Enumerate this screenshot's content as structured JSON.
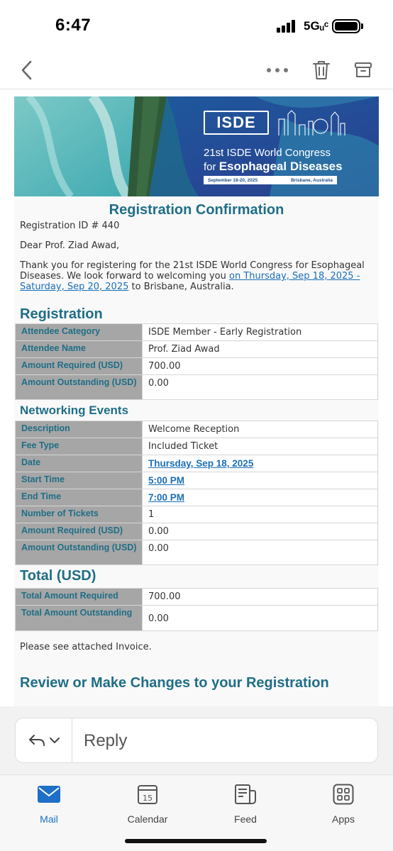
{
  "status_bar": {
    "time": "6:47",
    "network": "5Gᵤᶜ"
  },
  "email": {
    "banner": {
      "logo": "ISDE",
      "title_line1": "21st ISDE World Congress",
      "title_line2_prefix": "for",
      "title_line2_bold": "Esophageal Diseases",
      "dates": "September 18-20, 2025",
      "location": "Brisbane, Australia"
    },
    "title": "Registration Confirmation",
    "registration_id": "Registration ID # 440",
    "greeting": "Dear Prof. Ziad Awad,",
    "thanks_before": "Thank you for registering for the 21st ISDE World Congress for Esophageal Diseases. We look forward to welcoming you ",
    "thanks_link": "on Thursday, Sep 18, 2025 - Saturday, Sep 20, 2025",
    "thanks_after": " to Brisbane, Australia.",
    "registration": {
      "heading": "Registration",
      "rows": [
        {
          "key": "Attendee Category",
          "value": "ISDE Member - Early Registration"
        },
        {
          "key": "Attendee Name",
          "value": "Prof. Ziad Awad"
        },
        {
          "key": "Amount Required (USD)",
          "value": "700.00"
        },
        {
          "key": "Amount Outstanding (USD)",
          "value": "0.00"
        }
      ]
    },
    "networking": {
      "heading": "Networking Events",
      "rows": [
        {
          "key": "Description",
          "value": "Welcome Reception"
        },
        {
          "key": "Fee Type",
          "value": "Included Ticket"
        },
        {
          "key": "Date",
          "value": "Thursday, Sep 18, 2025"
        },
        {
          "key": "Start Time",
          "value": "5:00 PM"
        },
        {
          "key": "End Time",
          "value": "7:00 PM"
        },
        {
          "key": "Number of Tickets",
          "value": "1"
        },
        {
          "key": "Amount Required (USD)",
          "value": "0.00"
        },
        {
          "key": "Amount Outstanding (USD)",
          "value": "0.00"
        }
      ]
    },
    "total": {
      "heading": "Total (USD)",
      "rows": [
        {
          "key": "Total Amount Required",
          "value": "700.00"
        },
        {
          "key": "Total Amount Outstanding",
          "value": "0.00"
        }
      ]
    },
    "note": "Please see attached Invoice.",
    "review_heading": "Review or Make Changes to your Registration"
  },
  "reply": {
    "label": "Reply"
  },
  "tabs": [
    {
      "label": "Mail",
      "icon": "mail-icon",
      "active": true
    },
    {
      "label": "Calendar",
      "icon": "calendar-icon",
      "day": "15"
    },
    {
      "label": "Feed",
      "icon": "feed-icon"
    },
    {
      "label": "Apps",
      "icon": "apps-icon"
    }
  ],
  "colors": {
    "accent": "#1e6fc8",
    "heading_teal": "#1f6e86",
    "key_cell": "#a6a6a6",
    "link": "#1a6fb8"
  }
}
